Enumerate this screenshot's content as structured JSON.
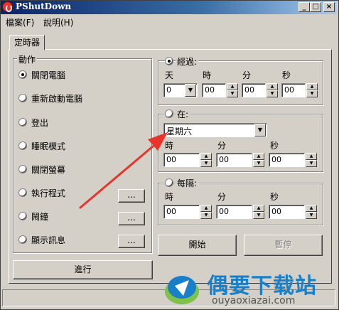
{
  "window": {
    "title": "PShutDown",
    "minimize": "_",
    "maximize": "□",
    "close": "×"
  },
  "menu": {
    "file": "檔案(F)",
    "help": "說明(H)"
  },
  "tab": {
    "label": "定時器"
  },
  "actions": {
    "group_label": "動作",
    "items": [
      {
        "label": "關閉電腦",
        "selected": true
      },
      {
        "label": "重新啟動電腦",
        "selected": false
      },
      {
        "label": "登出",
        "selected": false
      },
      {
        "label": "睡眠模式",
        "selected": false
      },
      {
        "label": "關閉螢幕",
        "selected": false
      },
      {
        "label": "執行程式",
        "selected": false
      },
      {
        "label": "鬧鐘",
        "selected": false
      },
      {
        "label": "顯示訊息",
        "selected": false
      }
    ],
    "browse_label": "...",
    "go_button": "進行"
  },
  "after": {
    "label": "經過:",
    "selected": true,
    "col_day": "天",
    "col_hour": "時",
    "col_min": "分",
    "col_sec": "秒",
    "day_value": "0",
    "hour_value": "00",
    "min_value": "00",
    "sec_value": "00"
  },
  "at": {
    "label": "在:",
    "selected": false,
    "weekday_value": "星期六",
    "col_hour": "時",
    "col_min": "分",
    "col_sec": "秒",
    "hour_value": "00",
    "min_value": "00",
    "sec_value": "00"
  },
  "every": {
    "label": "每隔:",
    "selected": false,
    "col_hour": "時",
    "col_min": "分",
    "col_sec": "秒",
    "hour_value": "00",
    "min_value": "00",
    "sec_value": "00"
  },
  "controls": {
    "start": "開始",
    "pause": "暫停"
  },
  "watermark": {
    "brand": "偶要下载站",
    "url": "ouyaoxiazai.com"
  },
  "colors": {
    "arrow": "#e8342a",
    "title_bar": "#0a246a",
    "face": "#d4d0c8",
    "watermark": "#1a7fc9"
  }
}
